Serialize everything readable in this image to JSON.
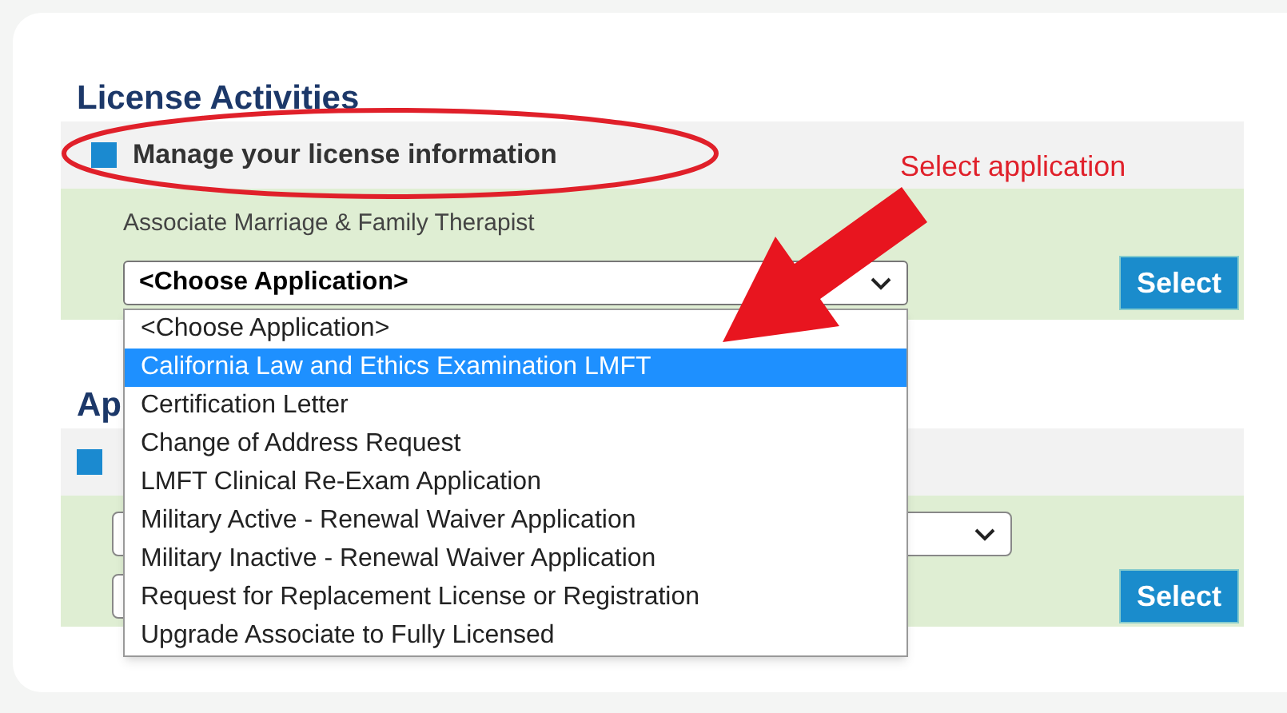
{
  "sections": [
    {
      "title": "License Activities",
      "subtitle": "Manage your license information",
      "license_type": "Associate Marriage & Family Therapist",
      "select_value": "<Choose Application>",
      "button": "Select"
    },
    {
      "title": "Ap",
      "button": "Select"
    }
  ],
  "dropdown": {
    "options": [
      {
        "label": "<Choose Application>",
        "selected": false
      },
      {
        "label": "California Law and Ethics Examination LMFT",
        "selected": true
      },
      {
        "label": "Certification Letter",
        "selected": false
      },
      {
        "label": "Change of Address Request",
        "selected": false
      },
      {
        "label": "LMFT Clinical Re-Exam Application",
        "selected": false
      },
      {
        "label": "Military Active - Renewal Waiver Application",
        "selected": false
      },
      {
        "label": "Military Inactive - Renewal Waiver Application",
        "selected": false
      },
      {
        "label": "Request for Replacement License or Registration",
        "selected": false
      },
      {
        "label": "Upgrade Associate to Fully Licensed",
        "selected": false
      }
    ]
  },
  "annotation": {
    "callout": "Select application"
  }
}
